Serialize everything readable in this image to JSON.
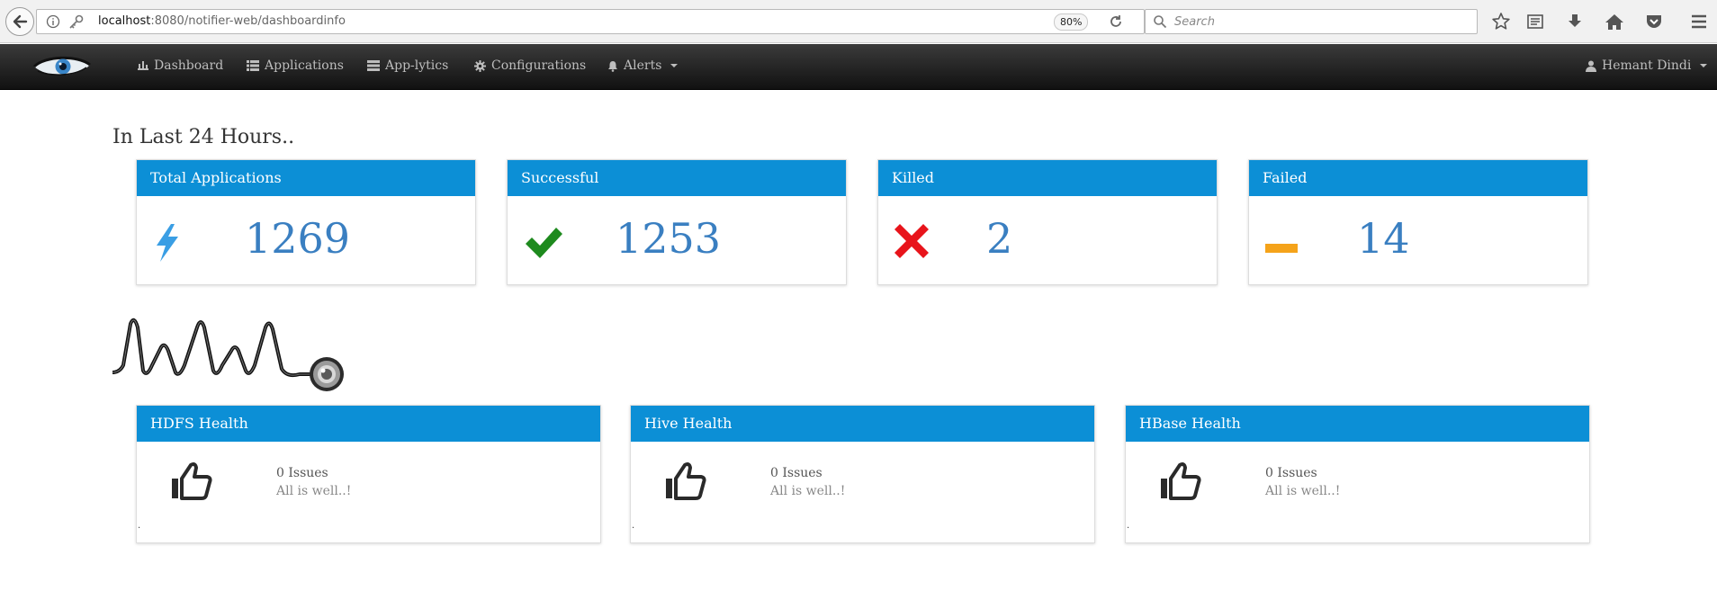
{
  "browser": {
    "url_host": "localhost",
    "url_rest": ":8080/notifier-web/dashboardinfo",
    "zoom": "80%",
    "search_placeholder": "Search"
  },
  "navbar": {
    "items": [
      {
        "label": "Dashboard",
        "icon": "bar-chart-icon"
      },
      {
        "label": "Applications",
        "icon": "list-icon"
      },
      {
        "label": "App-lytics",
        "icon": "server-icon"
      },
      {
        "label": "Configurations",
        "icon": "gear-icon"
      },
      {
        "label": "Alerts",
        "icon": "bell-icon"
      }
    ],
    "user": "Hemant Dindi"
  },
  "summary": {
    "title": "In Last 24 Hours..",
    "cards": [
      {
        "label": "Total Applications",
        "value": "1269",
        "icon": "lightning-icon",
        "color": "#3a9ee4"
      },
      {
        "label": "Successful",
        "value": "1253",
        "icon": "check-icon",
        "color": "#1e8a1e"
      },
      {
        "label": "Killed",
        "value": "2",
        "icon": "cross-icon",
        "color": "#e8141b"
      },
      {
        "label": "Failed",
        "value": "14",
        "icon": "minus-icon",
        "color": "#f5a31a"
      }
    ]
  },
  "health": {
    "cards": [
      {
        "label": "HDFS Health",
        "issues": "0 Issues",
        "status": "All is well..!",
        "footer": "."
      },
      {
        "label": "Hive Health",
        "issues": "0 Issues",
        "status": "All is well..!",
        "footer": "."
      },
      {
        "label": "HBase Health",
        "issues": "0 Issues",
        "status": "All is well..!",
        "footer": "."
      }
    ]
  },
  "colors": {
    "card_header": "#0c8fd6",
    "stat_value": "#3a7fc1",
    "navbar_bg": "#1b1b1b"
  }
}
